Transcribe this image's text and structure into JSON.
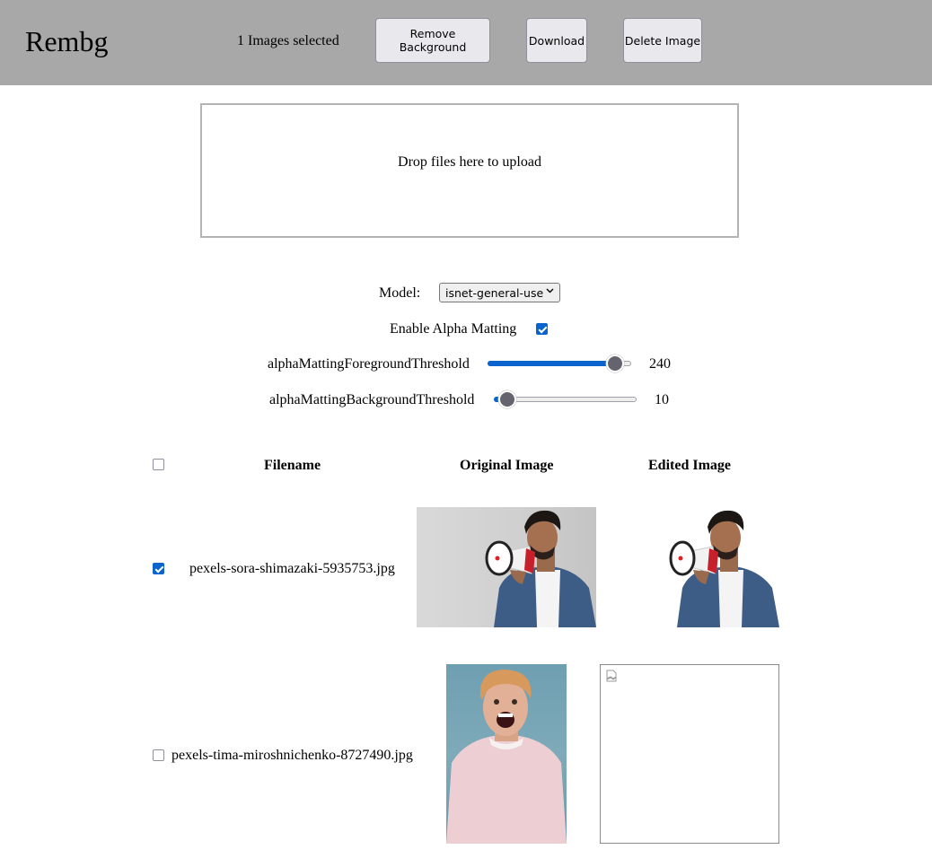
{
  "header": {
    "app_title": "Rembg",
    "selection_status": "1 Images selected",
    "buttons": {
      "remove_background": "Remove Background",
      "download": "Download",
      "delete_image": "Delete Image"
    },
    "background_color": "#a8a8a8"
  },
  "upload": {
    "prompt": "Drop files here to upload"
  },
  "settings": {
    "model": {
      "label": "Model:",
      "selected": "isnet-general-use",
      "chevron": "⌄"
    },
    "alpha_matting": {
      "label": "Enable Alpha Matting",
      "checked": true
    },
    "foreground_threshold": {
      "label": "alphaMattingForegroundThreshold",
      "value": 240,
      "min": 0,
      "max": 255,
      "display": "240"
    },
    "background_threshold": {
      "label": "alphaMattingBackgroundThreshold",
      "value": 10,
      "min": 0,
      "max": 255,
      "display": "10"
    },
    "accent_color": "#0b63ce"
  },
  "table": {
    "headers": {
      "select_all_checked": false,
      "filename": "Filename",
      "original_image": "Original Image",
      "edited_image": "Edited Image"
    },
    "rows": [
      {
        "checked": true,
        "filename": "pexels-sora-shimazaki-5935753.jpg",
        "original_image": "man-with-megaphone-photo",
        "edited_image": "man-with-megaphone-background-removed"
      },
      {
        "checked": false,
        "filename": "pexels-tima-miroshnichenko-8727490.jpg",
        "original_image": "man-shouting-pink-shirt-photo",
        "edited_image": "broken-image-icon"
      }
    ]
  }
}
